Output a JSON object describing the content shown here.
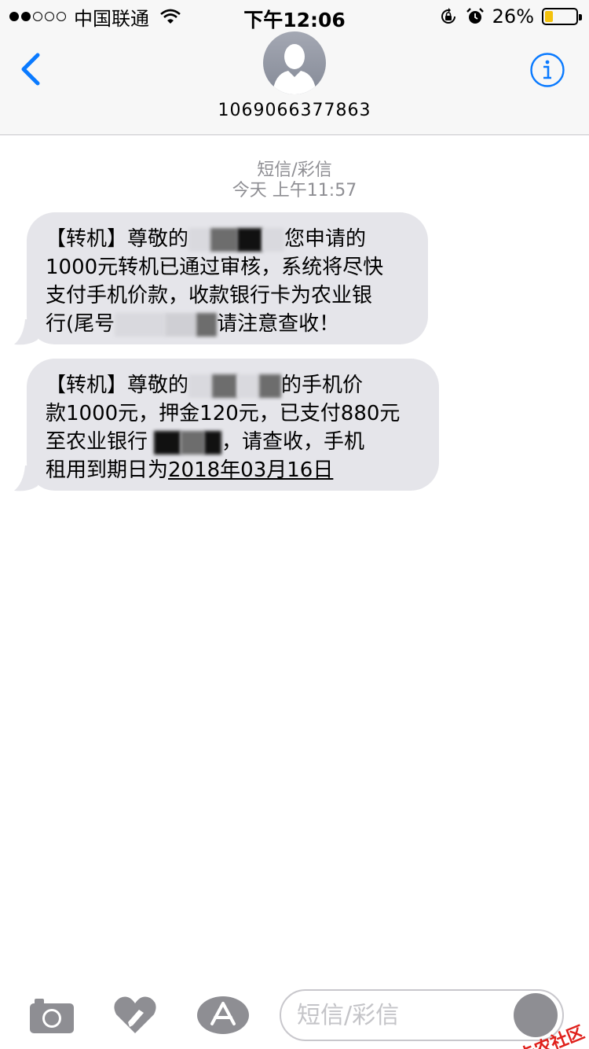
{
  "status_bar": {
    "signal_dots_filled": 2,
    "signal_dots_total": 5,
    "carrier": "中国联通",
    "time": "下午12:06",
    "battery_percent_label": "26%",
    "battery_level": 0.26,
    "battery_color": "#f4c20d"
  },
  "nav": {
    "contact_number": "1069066377863",
    "accent_color": "#0a7aff"
  },
  "conversation": {
    "message_type": "短信/彩信",
    "timestamp": "今天 上午11:57",
    "messages": [
      {
        "line1_a": "【转机】尊敬的",
        "line1_b": "您申请的",
        "line2": "1000元转机已通过审核，系统将尽快",
        "line3": "支付手机价款，收款银行卡为农业银",
        "line4_a": "行(尾号",
        "line4_b": "请注意查收！"
      },
      {
        "line1_a": "【转机】尊敬的",
        "line1_b": "的手机价",
        "line2": "款1000元，押金120元，已支付880元",
        "line3_a": "至农业银行",
        "line3_b": "，请查收，手机",
        "line4_a": "租用到期日为",
        "line4_b": "2018年03月16日"
      }
    ]
  },
  "input_bar": {
    "placeholder": "短信/彩信",
    "icons": [
      "camera-icon",
      "digital-touch-icon",
      "app-store-icon",
      "microphone-icon"
    ]
  },
  "watermark": {
    "text": "卡农社区"
  }
}
